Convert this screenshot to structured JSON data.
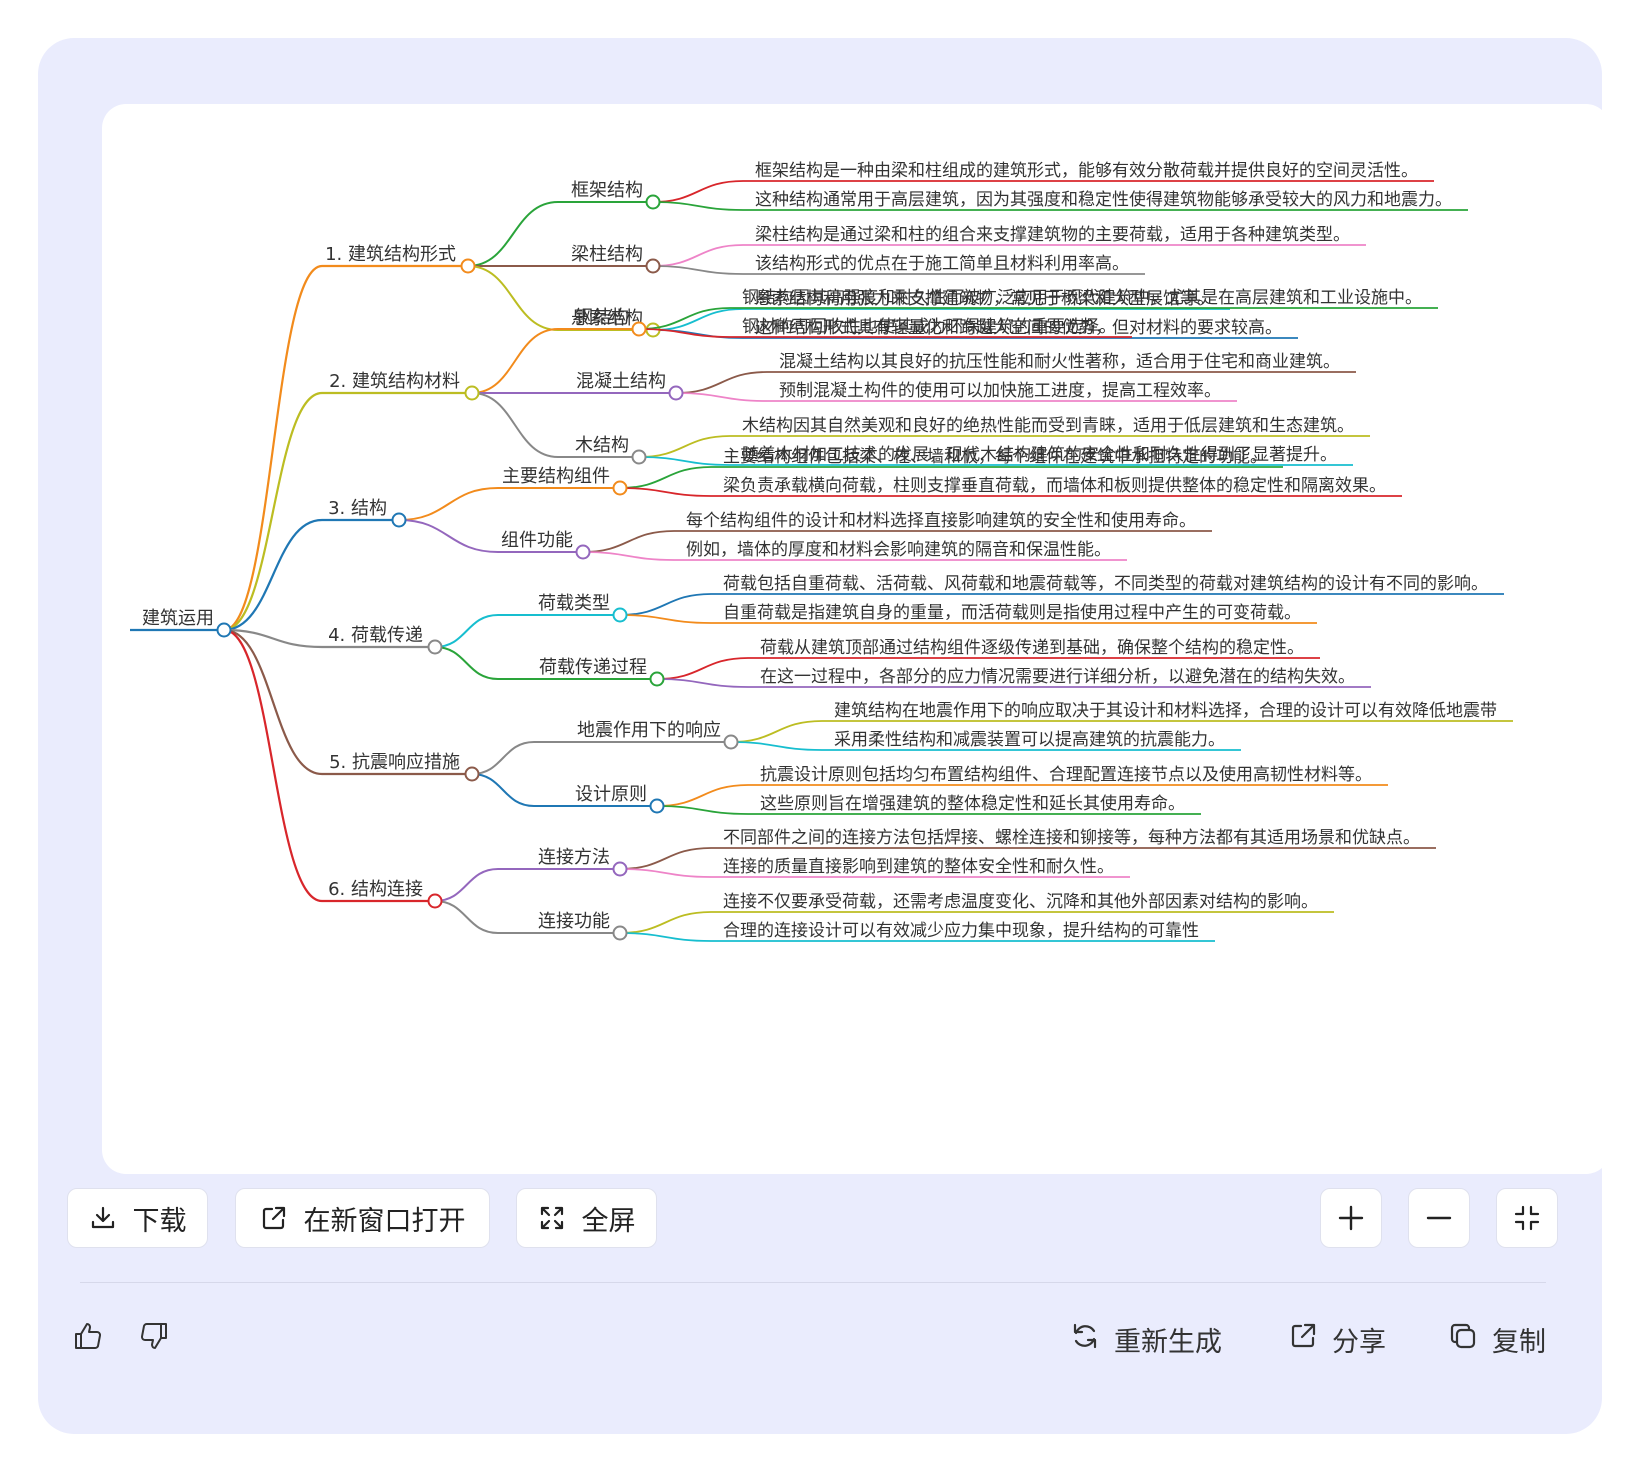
{
  "mindmap": {
    "root": "建筑运用",
    "branches": [
      {
        "label": "1. 建筑结构形式",
        "color": "#f28b1c",
        "children": [
          {
            "label": "框架结构",
            "color": "#2aa43a",
            "leaves": [
              {
                "text": "框架结构是一种由梁和柱组成的建筑形式，能够有效分散荷载并提供良好的空间灵活性。",
                "color": "#d8262b"
              },
              {
                "text": "这种结构通常用于高层建筑，因为其强度和稳定性使得建筑物能够承受较大的风力和地震力。",
                "color": "#2aa43a"
              }
            ]
          },
          {
            "label": "梁柱结构",
            "color": "#8b5a4a",
            "leaves": [
              {
                "text": "梁柱结构是通过梁和柱的组合来支撑建筑物的主要荷载，适用于各种建筑类型。",
                "color": "#ee84c8"
              },
              {
                "text": "该结构形式的优点在于施工简单且材料利用率高。",
                "color": "#888888"
              }
            ]
          },
          {
            "label": "悬索结构",
            "color": "#bcbd22",
            "leaves": [
              {
                "text": "悬索结构利用张力来支撑建筑物，常见于桥梁和大型展馆等。",
                "color": "#17becf"
              },
              {
                "text": "这种结构形式具有轻量化和跨越大空间的优势，但对材料的要求较高。",
                "color": "#1f77b4"
              }
            ]
          }
        ]
      },
      {
        "label": "2. 建筑结构材料",
        "color": "#bcbd22",
        "children": [
          {
            "label": "钢结构",
            "color": "#f28b1c",
            "leaves": [
              {
                "text": "钢结构因其高强度和耐久性而被广泛应用于现代建筑中，尤其是在高层建筑和工业设施中。",
                "color": "#2aa43a"
              },
              {
                "text": "钢材的可回收性也使其成为环保建筑的重要选择。",
                "color": "#d8262b"
              }
            ]
          },
          {
            "label": "混凝土结构",
            "color": "#9467bd",
            "leaves": [
              {
                "text": "混凝土结构以其良好的抗压性能和耐火性著称，适合用于住宅和商业建筑。",
                "color": "#8b5a4a"
              },
              {
                "text": "预制混凝土构件的使用可以加快施工进度，提高工程效率。",
                "color": "#ee84c8"
              }
            ]
          },
          {
            "label": "木结构",
            "color": "#888888",
            "leaves": [
              {
                "text": "木结构因其自然美观和良好的绝热性能而受到青睐，适用于低层建筑和生态建筑。",
                "color": "#bcbd22"
              },
              {
                "text": "随着木材加工技术的发展，现代木结构建筑的安全性和耐久性得到了显著提升。",
                "color": "#17becf"
              }
            ]
          }
        ]
      },
      {
        "label": "3. 结构",
        "color": "#1f77b4",
        "children": [
          {
            "label": "主要结构组件",
            "color": "#f28b1c",
            "leaves": [
              {
                "text": "主要结构组件包括梁、柱、墙和板，每个组件在建筑中承担特定的功能。",
                "color": "#2aa43a"
              },
              {
                "text": "梁负责承载横向荷载，柱则支撑垂直荷载，而墙体和板则提供整体的稳定性和隔离效果。",
                "color": "#d8262b"
              }
            ]
          },
          {
            "label": "组件功能",
            "color": "#9467bd",
            "leaves": [
              {
                "text": "每个结构组件的设计和材料选择直接影响建筑的安全性和使用寿命。",
                "color": "#8b5a4a"
              },
              {
                "text": "例如，墙体的厚度和材料会影响建筑的隔音和保温性能。",
                "color": "#ee84c8"
              }
            ]
          }
        ]
      },
      {
        "label": "4. 荷载传递",
        "color": "#888888",
        "children": [
          {
            "label": "荷载类型",
            "color": "#17becf",
            "leaves": [
              {
                "text": "荷载包括自重荷载、活荷载、风荷载和地震荷载等，不同类型的荷载对建筑结构的设计有不同的影响。",
                "color": "#1f77b4"
              },
              {
                "text": "自重荷载是指建筑自身的重量，而活荷载则是指使用过程中产生的可变荷载。",
                "color": "#f28b1c"
              }
            ]
          },
          {
            "label": "荷载传递过程",
            "color": "#2aa43a",
            "leaves": [
              {
                "text": "荷载从建筑顶部通过结构组件逐级传递到基础，确保整个结构的稳定性。",
                "color": "#d8262b"
              },
              {
                "text": "在这一过程中，各部分的应力情况需要进行详细分析，以避免潜在的结构失效。",
                "color": "#9467bd"
              }
            ]
          }
        ]
      },
      {
        "label": "5. 抗震响应措施",
        "color": "#8b5a4a",
        "children": [
          {
            "label": "地震作用下的响应",
            "color": "#888888",
            "leaves": [
              {
                "text": "建筑结构在地震作用下的响应取决于其设计和材料选择，合理的设计可以有效降低地震带",
                "color": "#bcbd22"
              },
              {
                "text": "采用柔性结构和减震装置可以提高建筑的抗震能力。",
                "color": "#17becf"
              }
            ]
          },
          {
            "label": "设计原则",
            "color": "#1f77b4",
            "leaves": [
              {
                "text": "抗震设计原则包括均匀布置结构组件、合理配置连接节点以及使用高韧性材料等。",
                "color": "#f28b1c"
              },
              {
                "text": "这些原则旨在增强建筑的整体稳定性和延长其使用寿命。",
                "color": "#2aa43a"
              }
            ]
          }
        ]
      },
      {
        "label": "6. 结构连接",
        "color": "#d8262b",
        "children": [
          {
            "label": "连接方法",
            "color": "#9467bd",
            "leaves": [
              {
                "text": "不同部件之间的连接方法包括焊接、螺栓连接和铆接等，每种方法都有其适用场景和优缺点。",
                "color": "#8b5a4a"
              },
              {
                "text": "连接的质量直接影响到建筑的整体安全性和耐久性。",
                "color": "#ee84c8"
              }
            ]
          },
          {
            "label": "连接功能",
            "color": "#888888",
            "leaves": [
              {
                "text": "连接不仅要承受荷载，还需考虑温度变化、沉降和其他外部因素对结构的影响。",
                "color": "#bcbd22"
              },
              {
                "text": "合理的连接设计可以有效减少应力集中现象，提升结构的可靠性",
                "color": "#17becf"
              }
            ]
          }
        ]
      }
    ]
  },
  "toolbar": {
    "download_label": "下载",
    "open_new_window_label": "在新窗口打开",
    "fullscreen_label": "全屏"
  },
  "actions": {
    "regenerate_label": "重新生成",
    "share_label": "分享",
    "copy_label": "复制"
  },
  "icons": {
    "download": "download-icon",
    "open": "external-link-icon",
    "fullscreen": "expand-icon",
    "zoom_in": "plus-icon",
    "zoom_out": "minus-icon",
    "fit": "collapse-icon",
    "like": "thumbs-up-icon",
    "dislike": "thumbs-down-icon",
    "regenerate": "refresh-icon",
    "share": "share-icon",
    "copy": "copy-icon"
  }
}
